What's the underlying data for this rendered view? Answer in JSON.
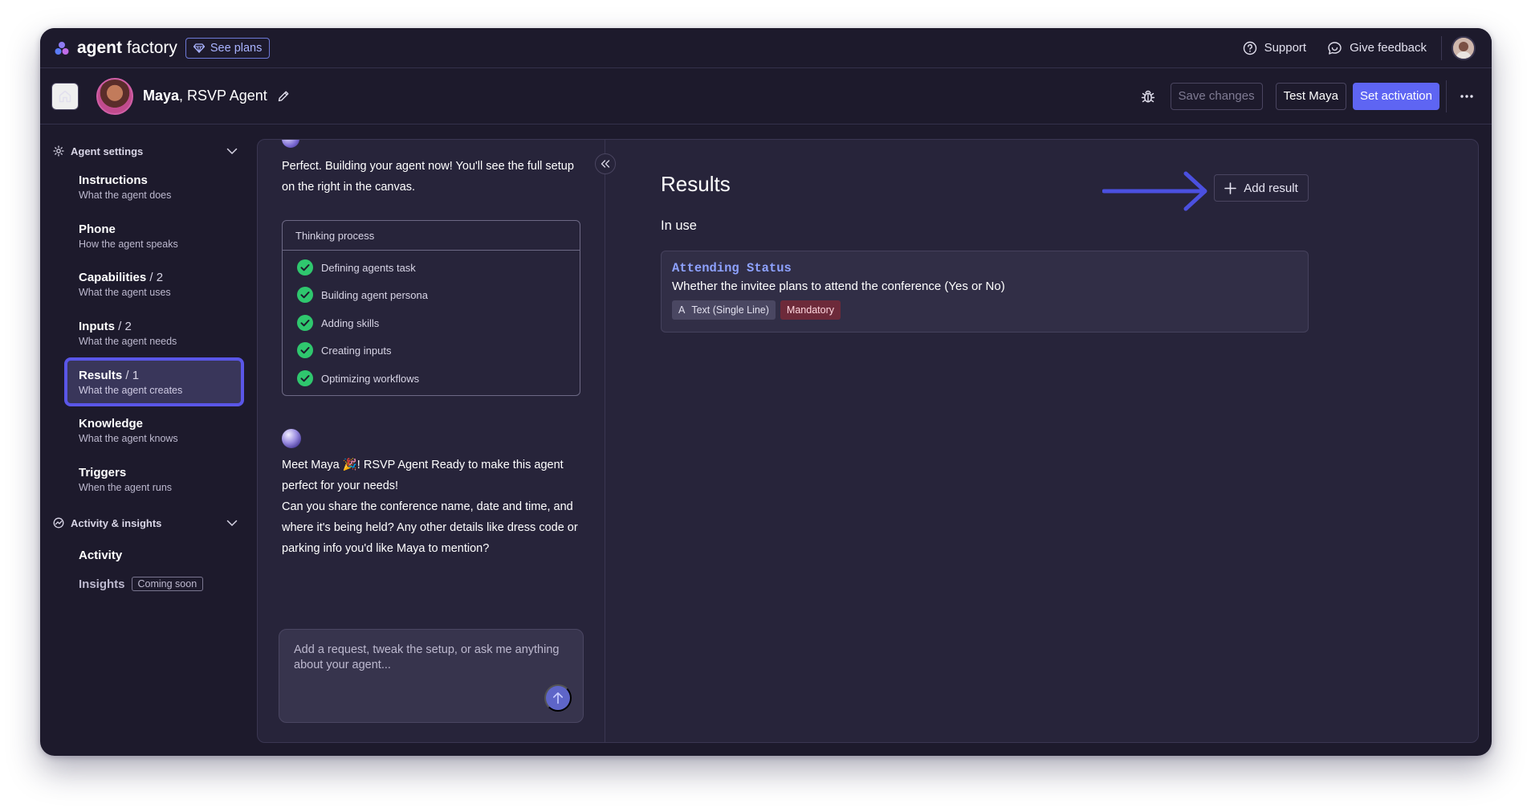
{
  "topbar": {
    "brand_bold": "agent",
    "brand_rest": " factory",
    "see_plans": "See plans",
    "support": "Support",
    "give_feedback": "Give feedback"
  },
  "agentbar": {
    "agent_name": "Maya",
    "agent_role": ", RSVP Agent",
    "save_changes": "Save changes",
    "test": "Test Maya",
    "set_activation": "Set activation"
  },
  "sidebar": {
    "agent_settings": "Agent settings",
    "items": [
      {
        "title": "Instructions",
        "count": "",
        "sub": "What the agent does"
      },
      {
        "title": "Phone",
        "count": "",
        "sub": "How the agent speaks"
      },
      {
        "title": "Capabilities",
        "count": " / 2",
        "sub": "What the agent uses"
      },
      {
        "title": "Inputs",
        "count": " / 2",
        "sub": "What the agent needs"
      },
      {
        "title": "Results",
        "count": " / 1",
        "sub": "What the agent creates"
      },
      {
        "title": "Knowledge",
        "count": "",
        "sub": "What the agent knows"
      },
      {
        "title": "Triggers",
        "count": "",
        "sub": "When the agent runs"
      }
    ],
    "activity_insights": "Activity & insights",
    "activity": "Activity",
    "insights": "Insights",
    "coming_soon": "Coming soon"
  },
  "chat": {
    "message_1": "Perfect. Building your agent now! You'll see the full setup on the right in the canvas.",
    "thinking_title": "Thinking process",
    "steps": [
      "Defining agents task",
      "Building agent persona",
      "Adding skills",
      "Creating inputs",
      "Optimizing workflows"
    ],
    "message_2_line_1": "Meet Maya 🎉! RSVP Agent Ready to make this agent perfect for your needs!",
    "message_2_line_2": "Can you share the conference name, date and time, and where it's being held? Any other details like dress code or parking info you'd like Maya to mention?",
    "composer_placeholder": "Add a request, tweak the setup, or ask me anything about your agent..."
  },
  "canvas": {
    "title": "Results",
    "in_use": "In use",
    "add_result": "Add result",
    "results": [
      {
        "name": "Attending Status",
        "description": "Whether the invitee plans to attend the conference (Yes or No)",
        "type_icon": "A",
        "type": "Text (Single Line)",
        "requirement": "Mandatory"
      }
    ]
  },
  "colors": {
    "accent": "#5e65f3",
    "active_border": "#5a56e8",
    "check_green": "#2fc76e",
    "result_name": "#8ea2ff",
    "mandatory_bg": "#6d2a3a",
    "arrow": "#4b50e0"
  }
}
